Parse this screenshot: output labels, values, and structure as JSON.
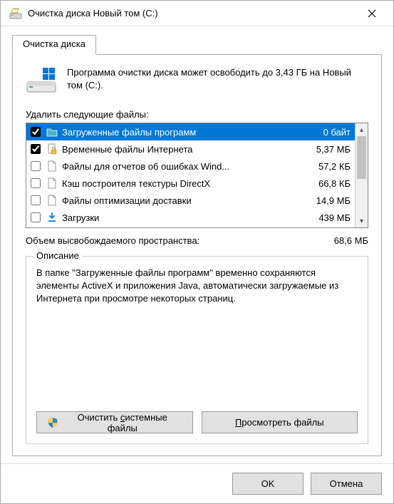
{
  "title": "Очистка диска Новый том (C:)",
  "tab_label": "Очистка диска",
  "intro_text": "Программа очистки диска может освободить до 3,43 ГБ на Новый том (C:).",
  "delete_label": "Удалить следующие файлы:",
  "files": [
    {
      "checked": true,
      "selected": true,
      "icon": "folder-cyan",
      "label": "Загруженные файлы программ",
      "size": "0 байт"
    },
    {
      "checked": true,
      "selected": false,
      "icon": "lock-file",
      "label": "Временные файлы Интернета",
      "size": "5,37 МБ"
    },
    {
      "checked": false,
      "selected": false,
      "icon": "file",
      "label": "Файлы для отчетов об ошибках Wind...",
      "size": "57,2 КБ"
    },
    {
      "checked": false,
      "selected": false,
      "icon": "file",
      "label": "Кэш построителя текстуры DirectX",
      "size": "66,8 КБ"
    },
    {
      "checked": false,
      "selected": false,
      "icon": "file",
      "label": "Файлы оптимизации доставки",
      "size": "14,9 МБ"
    },
    {
      "checked": false,
      "selected": false,
      "icon": "download",
      "label": "Загрузки",
      "size": "439 МБ"
    }
  ],
  "total_label": "Объем высвобождаемого пространства:",
  "total_value": "68,6 МБ",
  "group_title": "Описание",
  "description": "В папке \"Загруженные файлы программ\" временно сохраняются элементы ActiveX и приложения Java, автоматически загружаемые из Интернета при просмотре некоторых страниц.",
  "btn_clean_system": "Очистить системные файлы",
  "btn_view_files": "Просмотреть файлы",
  "btn_ok": "OK",
  "btn_cancel": "Отмена"
}
